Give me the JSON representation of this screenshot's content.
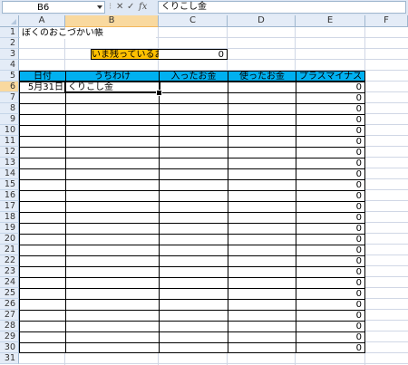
{
  "formula_bar": {
    "name_box": "B6",
    "formula": "くりこし金",
    "fx_label": "fx"
  },
  "columns": [
    "A",
    "B",
    "C",
    "D",
    "E",
    "F"
  ],
  "rows": [
    "1",
    "2",
    "3",
    "4",
    "5",
    "6",
    "7",
    "8",
    "9",
    "10",
    "11",
    "12",
    "13",
    "14",
    "15",
    "16",
    "17",
    "18",
    "19",
    "20",
    "21",
    "22",
    "23",
    "24",
    "25",
    "26",
    "27",
    "28",
    "29",
    "30",
    "31"
  ],
  "sheet": {
    "title": "ぼくのおこづかい帳",
    "remaining_label": "いま残っているお金",
    "remaining_value": "0",
    "table_headers": [
      "日付",
      "うちわけ",
      "入ったお金",
      "使ったお金",
      "プラスマイナス"
    ],
    "first_row": {
      "date": "5月31日",
      "item": "くりこし金"
    },
    "balance_values": [
      "0",
      "0",
      "0",
      "0",
      "0",
      "0",
      "0",
      "0",
      "0",
      "0",
      "0",
      "0",
      "0",
      "0",
      "0",
      "0",
      "0",
      "0",
      "0",
      "0",
      "0",
      "0",
      "0",
      "0",
      "0"
    ]
  },
  "colors": {
    "header_fill": "#00b0f0",
    "label_fill": "#ffc000",
    "selection": "#f9d99f"
  }
}
